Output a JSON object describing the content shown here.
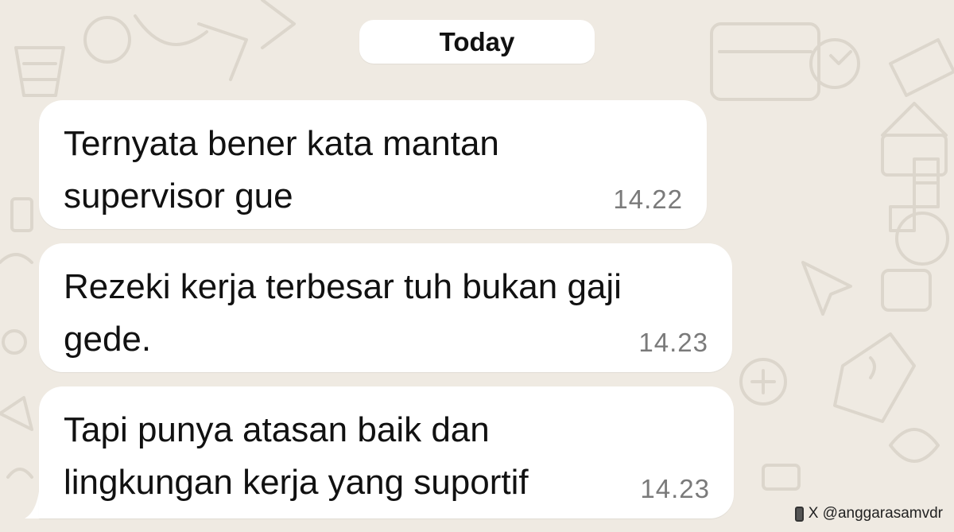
{
  "chat": {
    "date_label": "Today",
    "messages": [
      {
        "lines": [
          "Ternyata bener kata mantan",
          "supervisor gue"
        ],
        "time": "14.22"
      },
      {
        "lines": [
          "Rezeki kerja terbesar tuh bukan gaji",
          "gede."
        ],
        "time": "14.23"
      },
      {
        "lines": [
          "Tapi punya atasan baik dan",
          "lingkungan kerja yang suportif"
        ],
        "time": "14.23"
      }
    ]
  },
  "credit": {
    "text": "X @anggarasamvdr",
    "icon": "phone-icon"
  },
  "colors": {
    "background": "#efeae2",
    "bubble": "#ffffff",
    "text": "#111111",
    "timestamp": "#7a7a7a"
  }
}
